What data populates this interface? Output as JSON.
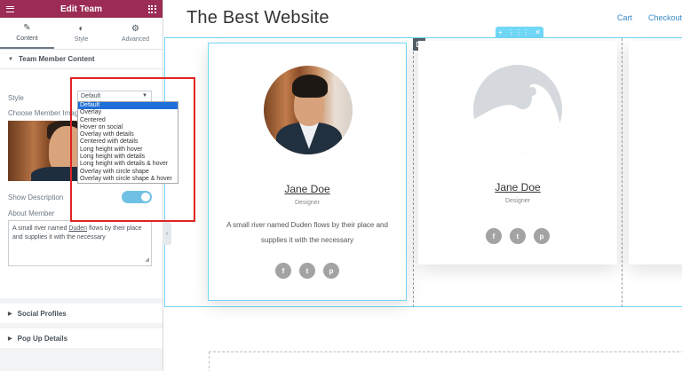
{
  "panel": {
    "title": "Edit Team",
    "tabs": [
      {
        "label": "Content",
        "icon": "pencil-icon"
      },
      {
        "label": "Style",
        "icon": "half-circle-icon"
      },
      {
        "label": "Advanced",
        "icon": "gear-icon"
      }
    ],
    "section_title": "Team Member Content",
    "style_label": "Style",
    "style_value": "Default",
    "choose_image_label": "Choose Member Image",
    "show_description_label": "Show Description",
    "about_member_label": "About Member",
    "about_text_before": "A small river named ",
    "about_text_link": "Duden",
    "about_text_after": " flows by their place and supplies it with the necessary",
    "style_options": [
      "Default",
      "Overlay",
      "Centered",
      "Hover on social",
      "Overlay with details",
      "Centered with details",
      "Long height with hover",
      "Long height with details",
      "Long height with details & hover",
      "Overlay with circle shape",
      "Overlay with circle shape & hover"
    ],
    "collapsed_sections": [
      "Social Profiles",
      "Pop Up Details"
    ]
  },
  "site": {
    "title": "The Best Website",
    "nav": [
      "Cart",
      "Checkout"
    ]
  },
  "cards": [
    {
      "name": "Jane Doe",
      "role": "Designer",
      "description": "A small river named Duden flows by their place and supplies it with the necessary"
    },
    {
      "name": "Jane Doe",
      "role": "Designer"
    }
  ],
  "social_icons": [
    "f",
    "t",
    "p"
  ],
  "colors": {
    "topbar": "#9b2c53",
    "accent": "#71d7f7",
    "highlight_box": "#e02424",
    "selected_option": "#1e6fd9"
  }
}
